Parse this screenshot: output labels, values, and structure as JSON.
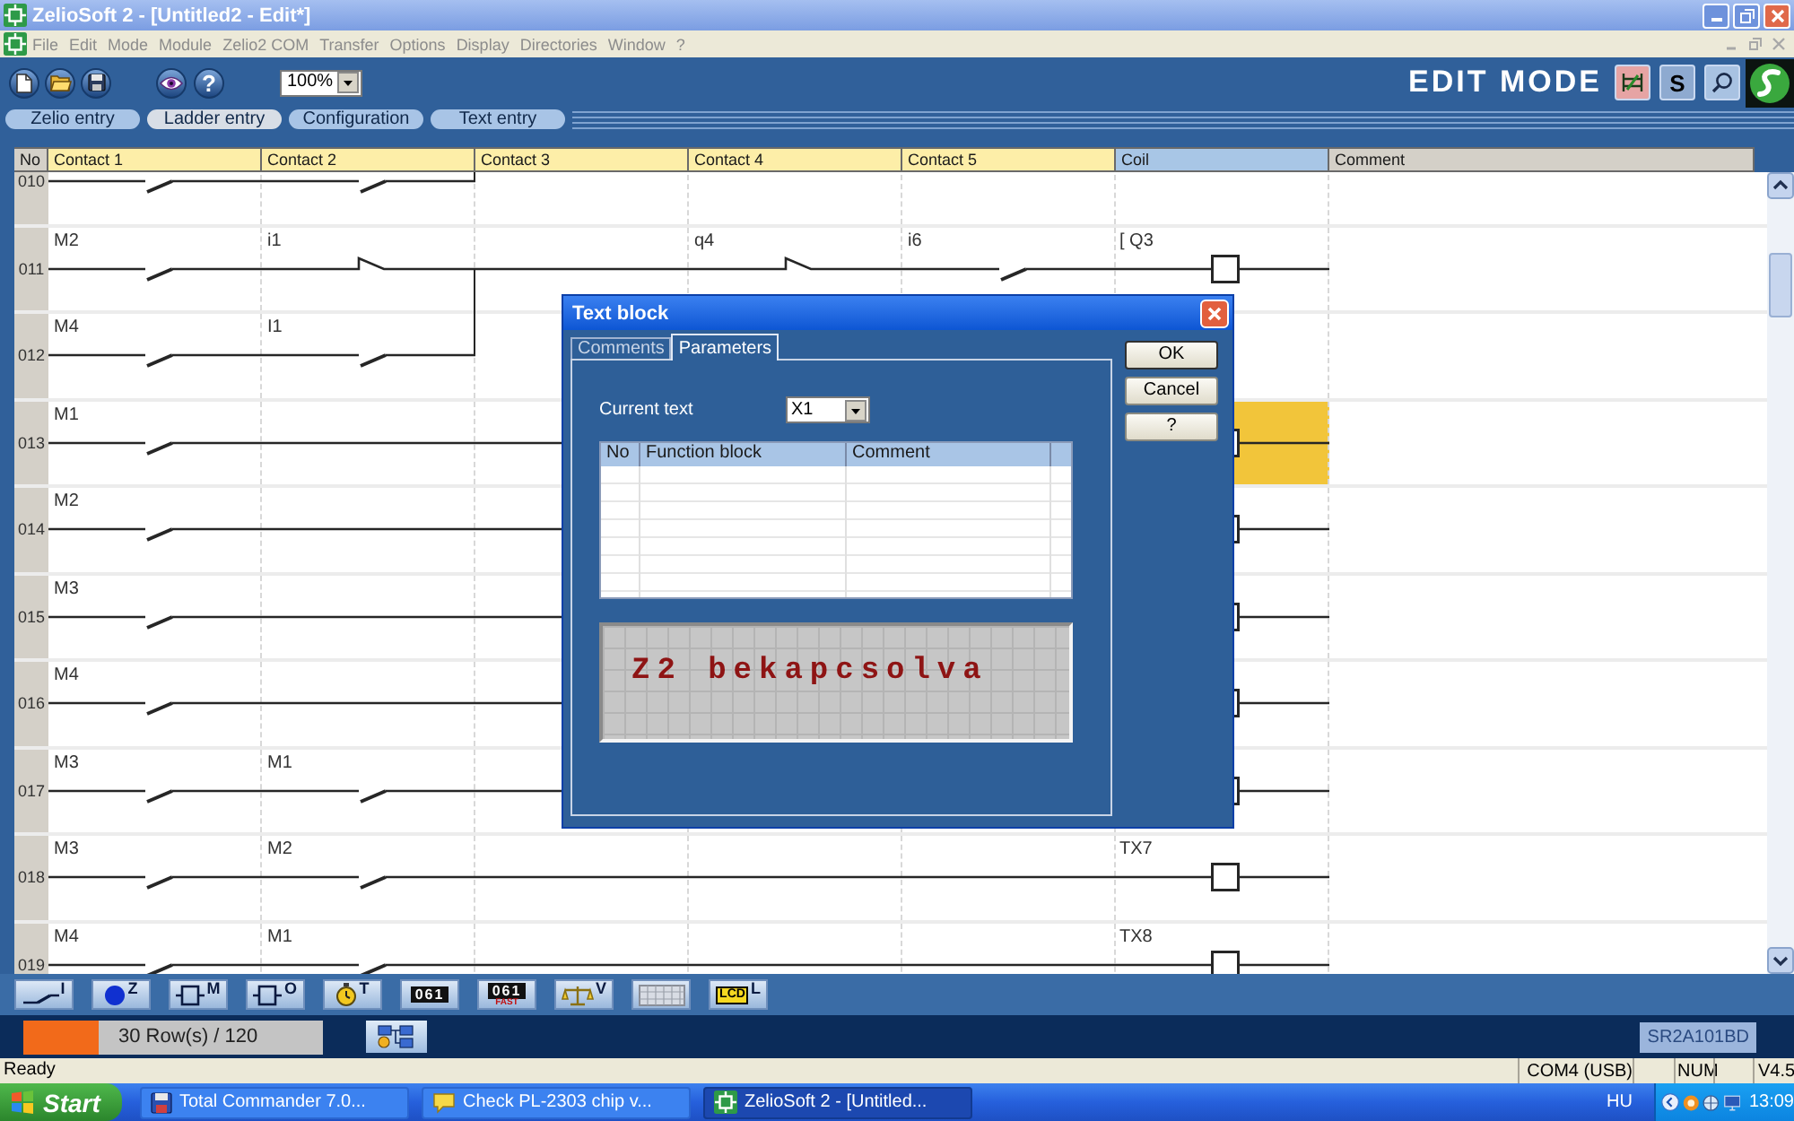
{
  "window": {
    "title": "ZelioSoft 2 - [Untitled2 - Edit*]"
  },
  "menu": [
    "File",
    "Edit",
    "Mode",
    "Module",
    "Zelio2 COM",
    "Transfer",
    "Options",
    "Display",
    "Directories",
    "Window",
    "?"
  ],
  "toolbar": {
    "groups": [
      [
        {
          "kind": "new"
        },
        {
          "kind": "open"
        },
        {
          "kind": "save"
        }
      ],
      [
        {
          "kind": "view"
        },
        {
          "kind": "help",
          "label": "?"
        }
      ]
    ],
    "zoom": "100%",
    "mode_label": "EDIT MODE",
    "mode_buttons": [
      {
        "kind": "ladder"
      },
      {
        "kind": "simulation",
        "label": "S"
      },
      {
        "kind": "search"
      }
    ]
  },
  "tabs": [
    {
      "label": "Zelio entry",
      "selected": false
    },
    {
      "label": "Ladder entry",
      "selected": true
    },
    {
      "label": "Configuration",
      "selected": false
    },
    {
      "label": "Text entry",
      "selected": false
    }
  ],
  "ladder": {
    "columns": [
      "No",
      "Contact 1",
      "Contact 2",
      "Contact 3",
      "Contact 4",
      "Contact 5",
      "Coil",
      "Comment"
    ],
    "rows": [
      {
        "no": "010",
        "contacts": [
          {
            "kind": "open",
            "join_up": false
          },
          {
            "kind": "open",
            "join_up": true
          }
        ],
        "coil": {
          "selected": false
        }
      },
      {
        "no": "011",
        "contacts": [
          {
            "kind": "open",
            "label": "M2",
            "join_up": false
          },
          {
            "kind": "closed",
            "label": "i1",
            "join_up": false
          },
          {
            "kind": "line",
            "join_up": false
          },
          {
            "kind": "closed",
            "label": "q4",
            "join_up": false
          },
          {
            "kind": "open",
            "label": "i6",
            "join_up": false
          }
        ],
        "coil": {
          "kind": "coil",
          "label": "[ Q3",
          "selected": false
        }
      },
      {
        "no": "012",
        "contacts": [
          {
            "kind": "open",
            "label": "M4",
            "join_up": false
          },
          {
            "kind": "open",
            "label": "I1",
            "join_up": true
          }
        ],
        "coil": {
          "selected": false
        }
      },
      {
        "no": "013",
        "contacts": [
          {
            "kind": "open",
            "label": "M1",
            "join_up": false
          },
          {
            "kind": "line",
            "join_up": false
          },
          {
            "kind": "line",
            "join_up": false
          }
        ],
        "coil": {
          "kind": "coil",
          "selected": true
        }
      },
      {
        "no": "014",
        "contacts": [
          {
            "kind": "open",
            "label": "M2",
            "join_up": false
          },
          {
            "kind": "line",
            "join_up": false
          },
          {
            "kind": "line",
            "join_up": false
          }
        ],
        "coil": {
          "kind": "coil",
          "selected": false
        }
      },
      {
        "no": "015",
        "contacts": [
          {
            "kind": "open",
            "label": "M3",
            "join_up": false
          },
          {
            "kind": "line",
            "join_up": false
          },
          {
            "kind": "line",
            "join_up": false
          }
        ],
        "coil": {
          "kind": "coil",
          "selected": false
        }
      },
      {
        "no": "016",
        "contacts": [
          {
            "kind": "open",
            "label": "M4",
            "join_up": false
          },
          {
            "kind": "line",
            "join_up": false
          },
          {
            "kind": "line",
            "join_up": false
          }
        ],
        "coil": {
          "kind": "coil",
          "selected": false
        }
      },
      {
        "no": "017",
        "contacts": [
          {
            "kind": "open",
            "label": "M3",
            "join_up": false
          },
          {
            "kind": "open",
            "label": "M1",
            "join_up": false
          },
          {
            "kind": "line",
            "join_up": false
          }
        ],
        "coil": {
          "kind": "coil",
          "selected": false
        }
      },
      {
        "no": "018",
        "contacts": [
          {
            "kind": "open",
            "label": "M3",
            "join_up": false
          },
          {
            "kind": "open",
            "label": "M2",
            "join_up": false
          },
          {
            "kind": "line",
            "join_up": false
          },
          {
            "kind": "line",
            "join_up": false
          },
          {
            "kind": "line",
            "join_up": false
          }
        ],
        "coil": {
          "kind": "coil",
          "label": "TX7",
          "selected": false
        }
      },
      {
        "no": "019",
        "contacts": [
          {
            "kind": "open",
            "label": "M4",
            "join_up": false
          },
          {
            "kind": "open",
            "label": "M1",
            "join_up": false
          },
          {
            "kind": "line",
            "join_up": false
          },
          {
            "kind": "line",
            "join_up": false
          },
          {
            "kind": "line",
            "join_up": false
          }
        ],
        "coil": {
          "kind": "coil",
          "label": "TX8",
          "selected": false
        }
      }
    ]
  },
  "dialog": {
    "title": "Text block",
    "tabs": [
      {
        "label": "Comments",
        "selected": false
      },
      {
        "label": "Parameters",
        "selected": true
      }
    ],
    "current_text": {
      "label": "Current text",
      "value": "X1"
    },
    "table": {
      "columns": [
        "No",
        "Function block",
        "Comment"
      ]
    },
    "preview": "Z2 bekapcsolva",
    "buttons": [
      {
        "kind": "ok",
        "label": "OK"
      },
      {
        "kind": "cancel",
        "label": "Cancel"
      },
      {
        "kind": "help",
        "label": "?"
      }
    ]
  },
  "function_toolbar": [
    {
      "kind": "contact",
      "letter": "I"
    },
    {
      "kind": "key",
      "letter": "Z"
    },
    {
      "kind": "relay",
      "letter": "M"
    },
    {
      "kind": "output",
      "letter": "O"
    },
    {
      "kind": "timer",
      "letter": "T"
    },
    {
      "kind": "counter",
      "display": "061"
    },
    {
      "kind": "fast_counter",
      "display": "061",
      "caption": "FAST"
    },
    {
      "kind": "compare",
      "letter": "V"
    },
    {
      "kind": "text"
    },
    {
      "kind": "lcd",
      "display": "LCD",
      "letter": "L"
    }
  ],
  "status_panel": {
    "rows": {
      "level": 0.25,
      "label": "30 Row(s) / 120"
    },
    "module": "SR2A101BD"
  },
  "status_bar": {
    "message": "Ready",
    "port": "COM4 (USB)",
    "num": "NUM",
    "version": "V4.5"
  },
  "taskbar": {
    "start": "Start",
    "tasks": [
      {
        "kind": "disk",
        "label": "Total Commander 7.0...",
        "selected": false
      },
      {
        "kind": "note",
        "label": "Check PL-2303 chip v...",
        "selected": false
      },
      {
        "kind": "app",
        "label": "ZelioSoft 2 - [Untitled...",
        "selected": true
      }
    ],
    "language": "HU",
    "clock": "13:09"
  }
}
